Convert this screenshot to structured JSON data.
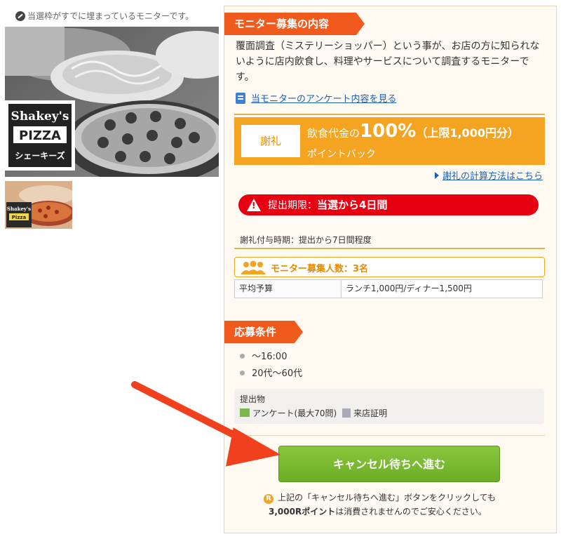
{
  "left": {
    "notice": "当選枠がすでに埋まっているモニターです。",
    "brand_logo": {
      "line1": "Shakey's",
      "line2": "PIZZA",
      "line3": "シェーキーズ"
    },
    "thumb_logo": {
      "line1": "Shakey's",
      "line2": "Pizza"
    }
  },
  "panel": {
    "section1_title": "モニター募集の内容",
    "description": "覆面調査（ミステリーショッパー）という事が、お店の方に知られないように店内飲食し、料理やサービスについて調査するモニターです。",
    "survey_link": "当モニターのアンケート内容を見る",
    "reward": {
      "label": "謝礼",
      "line1_prefix": "飲食代金の",
      "line1_percent": "100%",
      "line1_limit": "（上限1,000円分）",
      "line2": "ポイントバック"
    },
    "calc_link": "謝礼の計算方法はこちら",
    "deadline_label": "提出期限：",
    "deadline_value": "当選から4日間",
    "reward_timing": "謝礼付与時期：提出から7日間程度",
    "recruit_count": "モニター募集人数：3名",
    "budget": {
      "label": "平均予算",
      "value": "ランチ1,000円/ディナー1,500円"
    },
    "section2_title": "応募条件",
    "conditions": [
      "〜16:00",
      "20代〜60代"
    ],
    "submission": {
      "title": "提出物",
      "item1": "アンケート(最大70問)",
      "item2": "来店証明"
    },
    "cta_label": "キャンセル待ちへ進む",
    "footer_line1": "上記の「キャンセル待ちへ進む」ボタンをクリックしても",
    "footer_points": "3,000Rポイント",
    "footer_line2_rest": "は消費されませんのでご安心ください。",
    "footer_r_glyph": "R"
  },
  "colors": {
    "ribbon": "#f05a1d",
    "reward_bg": "#f4a420",
    "deadline_bg": "#e60012",
    "cta": "#7dbb33",
    "link": "#1b5fb7",
    "arrow": "#f0401e"
  },
  "icons": [
    "no-image-icon",
    "document-icon",
    "triangle-right-icon",
    "warning-icon",
    "people-icon",
    "bullet-dot-icon",
    "pencil-icon",
    "receipt-icon",
    "r-point-icon"
  ]
}
